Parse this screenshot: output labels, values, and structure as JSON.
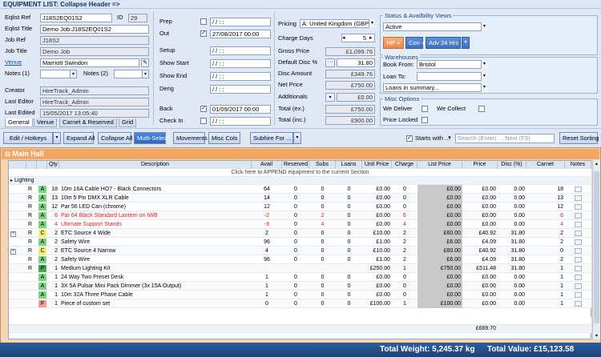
{
  "window": {
    "title": "EQUIPMENT LIST: Collapse Header =>"
  },
  "header": {
    "eqlist_ref_label": "Eqlist Ref",
    "eqlist_ref": "J18S2EQ01S2",
    "id_label": "ID",
    "id": "29",
    "eqlist_title_label": "Eqlist Title",
    "eqlist_title": "Demo Job:J18S2EQ01S2",
    "job_ref_label": "Job Ref",
    "job_ref": "J18S2",
    "job_title_label": "Job Title",
    "job_title": "Demo Job",
    "venue_label": "Venue",
    "venue": "Marriott Swindon",
    "notes1_label": "Notes (1)",
    "notes2_label": "Notes (2)",
    "creator_label": "Creator",
    "creator": "HireTrack_Admin",
    "last_editor_label": "Last Editor",
    "last_editor": "HireTrack_Admin",
    "last_edited_label": "Last Edited",
    "last_edited": "15/05/2017 13:05:40",
    "tabs": [
      "General",
      "Venue",
      "Carnet & Reserved",
      "Grid"
    ],
    "prep_label": "Prep",
    "prep_date": "/ /  : :",
    "out_label": "Out",
    "out_date": "27/08/2017 00:00",
    "setup_label": "Setup",
    "setup_date": "/ /  : :",
    "show_start_label": "Show Start",
    "show_start_date": "/ /  : :",
    "show_end_label": "Show End",
    "show_end_date": "/ /  : :",
    "derig_label": "Derig",
    "derig_date": "/ /  : :",
    "back_label": "Back",
    "back_date": "01/09/2017 00:00",
    "check_in_label": "Check In",
    "check_in_date": "/ /  : :",
    "pricing_label": "Pricing",
    "pricing": "A: United Kingdom (GBP)",
    "charge_days_label": "Charge Days",
    "charge_days": "5",
    "gross_price_label": "Gross Price",
    "gross_price": "£1,099.76",
    "default_disc_label": "Default Disc %",
    "default_disc": "31.80",
    "disc_amount_label": "Disc Amount",
    "disc_amount": "£349.76",
    "net_price_label": "Net Price",
    "net_price": "£750.00",
    "additionals_label": "Additionals",
    "additionals": "£0.00",
    "total_ex_label": "Total (ex.)",
    "total_ex": "£750.00",
    "total_inc_label": "Total (inc.)",
    "total_inc": "£900.00",
    "status_group": "Status & Availbility Views",
    "status": "Active",
    "hp_btn": "HP +",
    "con_btn": "Con +",
    "adv_btn": "Adv 24 Hrs",
    "warehouses_group": "Warehouses",
    "book_from_label": "Book From:",
    "book_from": "Bristol",
    "loan_to_label": "Loan To:",
    "loan_to": "",
    "loans_view": "Loans in summary...",
    "misc_group": "Misc Options",
    "we_deliver": "We Deliver",
    "we_collect": "We Collect",
    "price_locked": "Price Locked"
  },
  "toolbar": {
    "edit_hotkeys": "Edit / Hotkeys",
    "expand_all": "Expand All",
    "collapse_all": "Collapse All",
    "multi_select": "Multi-Select",
    "movements": "Movements",
    "misc_cols": "Misc Cols",
    "subhire_for": "Subhire For ...",
    "starts_with": "Starts with ...",
    "search_placeholder": "Search (Enter) ... Next (F3)",
    "reset_sorting": "Reset Sorting"
  },
  "section": {
    "title": "Main Hall",
    "append_hint": "Click here to APPEND equipment to the current Section",
    "group": "Lighting"
  },
  "columns": [
    "Qty",
    "Description",
    "Avail",
    "Reserved",
    "Subs",
    "Loans",
    "Unit Price",
    "Charge",
    "List Price",
    "Price",
    "Disc (%)",
    "Carnet",
    "Notes"
  ],
  "rows": [
    {
      "r": "R",
      "t": "A",
      "q": "18",
      "d": "10m 16A Cable HO7 - Black Connectors",
      "av": "64",
      "rs": "0",
      "sb": "0",
      "ln": "0",
      "up": "£0.00",
      "ch": "0",
      "lp": "£0.00",
      "pr": "£0.00",
      "dc": "0.00",
      "cn": "18",
      "red": false,
      "exp": false
    },
    {
      "r": "R",
      "t": "A",
      "q": "13",
      "d": "10m 5 Pin DMX XLR Cable",
      "av": "14",
      "rs": "0",
      "sb": "0",
      "ln": "0",
      "up": "£0.00",
      "ch": "0",
      "lp": "£0.00",
      "pr": "£0.00",
      "dc": "0.00",
      "cn": "13",
      "red": false,
      "exp": false
    },
    {
      "r": "R",
      "t": "A",
      "q": "12",
      "d": "Par 56 LED Can (chrome)",
      "av": "12",
      "rs": "0",
      "sb": "0",
      "ln": "0",
      "up": "£0.00",
      "ch": "0",
      "lp": "£0.00",
      "pr": "£0.00",
      "dc": "0.00",
      "cn": "12",
      "red": false,
      "exp": false
    },
    {
      "r": "R",
      "t": "A",
      "q": "6",
      "d": "Par 64 Black Standard Lantern on IWB",
      "av": "-2",
      "rs": "0",
      "sb": "2",
      "ln": "0",
      "up": "£0.00",
      "ch": "6",
      "lp": "£0.00",
      "pr": "£0.00",
      "dc": "0.00",
      "cn": "6",
      "red": true,
      "exp": false
    },
    {
      "r": "R",
      "t": "A",
      "q": "4",
      "d": "Ultimate Support Stands",
      "av": "-8",
      "rs": "0",
      "sb": "4",
      "ln": "0",
      "up": "£0.00",
      "ch": "4",
      "lp": "£0.00",
      "pr": "£0.00",
      "dc": "0.00",
      "cn": "4",
      "red": true,
      "exp": false
    },
    {
      "r": "R",
      "t": "C",
      "q": "2",
      "d": "ETC Source 4 Wide",
      "av": "2",
      "rs": "0",
      "sb": "0",
      "ln": "0",
      "up": "£10.00",
      "ch": "2",
      "lp": "£60.00",
      "pr": "£40.92",
      "dc": "31.80",
      "cn": "2",
      "red": false,
      "exp": true
    },
    {
      "r": "R",
      "t": "A",
      "q": "2",
      "d": "Safety Wire",
      "av": "96",
      "rs": "0",
      "sb": "0",
      "ln": "0",
      "up": "£1.00",
      "ch": "2",
      "lp": "£6.00",
      "pr": "£4.09",
      "dc": "31.80",
      "cn": "2",
      "red": false,
      "exp": false
    },
    {
      "r": "R",
      "t": "C",
      "q": "2",
      "d": "ETC Source 4 Narrow",
      "av": "4",
      "rs": "0",
      "sb": "0",
      "ln": "0",
      "up": "£10.00",
      "ch": "2",
      "lp": "£60.00",
      "pr": "£40.92",
      "dc": "31.80",
      "cn": "0",
      "red": false,
      "exp": true
    },
    {
      "r": "R",
      "t": "A",
      "q": "2",
      "d": "Safety Wire",
      "av": "96",
      "rs": "0",
      "sb": "0",
      "ln": "0",
      "up": "£1.00",
      "ch": "2",
      "lp": "£6.00",
      "pr": "£4.09",
      "dc": "31.80",
      "cn": "2",
      "red": false,
      "exp": false
    },
    {
      "r": "R",
      "t": "P",
      "q": "1",
      "d": "Medium Lighting Kit",
      "av": "",
      "rs": "",
      "sb": "",
      "ln": "",
      "up": "£250.00",
      "ch": "1",
      "lp": "£750.00",
      "pr": "£511.48",
      "dc": "31.80",
      "cn": "1",
      "red": false,
      "exp": false
    },
    {
      "r": "",
      "t": "A",
      "q": "1",
      "d": "24 Way Two Preset Desk",
      "av": "1",
      "rs": "0",
      "sb": "0",
      "ln": "0",
      "up": "£0.00",
      "ch": "0",
      "lp": "£0.00",
      "pr": "£0.00",
      "dc": "0.00",
      "cn": "1",
      "red": false,
      "exp": false
    },
    {
      "r": "",
      "t": "A",
      "q": "1",
      "d": "3X 5A Pulsar Mini Pack Dimmer (3x 15A Output)",
      "av": "1",
      "rs": "0",
      "sb": "0",
      "ln": "0",
      "up": "£0.00",
      "ch": "0",
      "lp": "£0.00",
      "pr": "£0.00",
      "dc": "0.00",
      "cn": "1",
      "red": false,
      "exp": false
    },
    {
      "r": "",
      "t": "A",
      "q": "1",
      "d": "10m 32A Three Phase Cable",
      "av": "1",
      "rs": "0",
      "sb": "0",
      "ln": "0",
      "up": "£0.00",
      "ch": "0",
      "lp": "£0.00",
      "pr": "£0.00",
      "dc": "0.00",
      "cn": "1",
      "red": false,
      "exp": false
    },
    {
      "r": "",
      "t": "F",
      "q": "1",
      "d": "Piece of custom set",
      "av": "0",
      "rs": "0",
      "sb": "0",
      "ln": "0",
      "up": "£100.00",
      "ch": "1",
      "lp": "£100.00",
      "pr": "£0.00",
      "dc": "0.00",
      "cn": "1",
      "red": false,
      "exp": false
    }
  ],
  "section_total": "£669.70",
  "status": {
    "total_weight": "Total Weight: 5,245.37 kg",
    "total_value": "Total Value: £15,123.58"
  },
  "colors": {
    "type_A": "#7fd47f",
    "type_C": "#f7ee6e",
    "type_P": "#4ca64c",
    "type_F": "#f49b9b",
    "accent": "#2d67bf",
    "section": "#f2a764"
  }
}
